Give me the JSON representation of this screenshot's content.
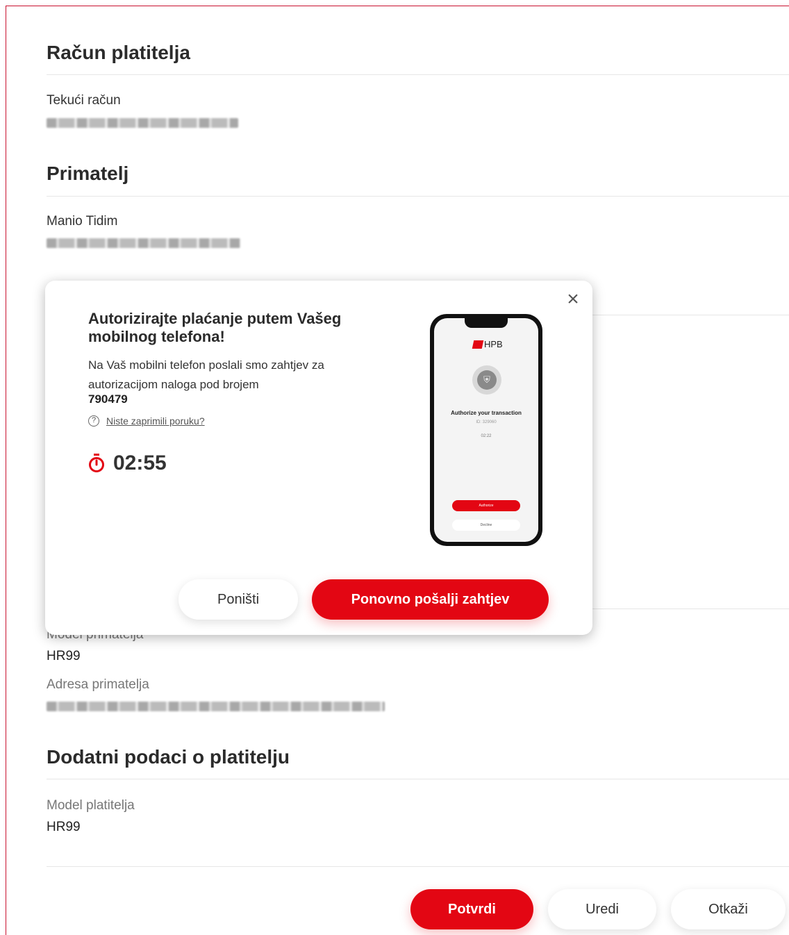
{
  "sections": {
    "payer_account": {
      "title": "Račun platitelja",
      "label": "Tekući račun"
    },
    "recipient": {
      "title": "Primatelj",
      "name": "Manio Tidim"
    },
    "recipient_details": {
      "model_label": "Model primatelja",
      "model_value": "HR99",
      "address_label": "Adresa primatelja"
    },
    "payer_extra": {
      "title": "Dodatni podaci o platitelju",
      "model_label": "Model platitelja",
      "model_value": "HR99"
    }
  },
  "actions": {
    "confirm": "Potvrdi",
    "edit": "Uredi",
    "cancel": "Otkaži"
  },
  "modal": {
    "title": "Autorizirajte plaćanje putem Vašeg mobilnog telefona!",
    "text": "Na Vaš mobilni telefon poslali smo zahtjev za autorizacijom naloga pod brojem",
    "order_number": "790479",
    "help_link": "Niste zaprimili poruku?",
    "timer": "02:55",
    "cancel_button": "Poništi",
    "resend_button": "Ponovno pošalji zahtjev",
    "phone": {
      "logo": "HPB",
      "auth_title": "Authorize your transaction",
      "auth_id": "ID: 329060",
      "auth_time": "02:22",
      "authorize_btn": "Authorize",
      "decline_btn": "Decline"
    }
  },
  "colors": {
    "accent": "#e30613",
    "frame": "#c8102e"
  }
}
